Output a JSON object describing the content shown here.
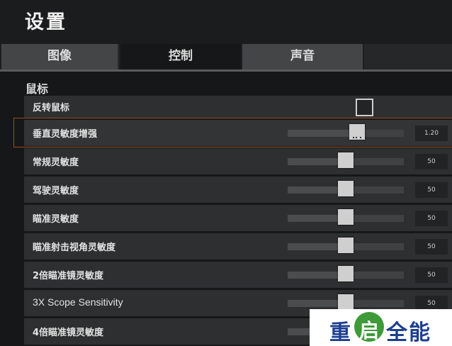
{
  "title": "设置",
  "tabs": [
    {
      "label": "图像"
    },
    {
      "label": "控制"
    },
    {
      "label": "声音"
    },
    {
      "label": ""
    }
  ],
  "section_title": "鼠标",
  "rows": [
    {
      "label": "反转鼠标",
      "type": "checkbox",
      "checked": false
    },
    {
      "label": "垂直灵敏度增强",
      "type": "slider",
      "value": "1.20",
      "level": 0.6,
      "highlighted": true
    },
    {
      "label": "常规灵敏度",
      "type": "slider",
      "value": "50",
      "level": 0.5
    },
    {
      "label": "驾驶灵敏度",
      "type": "slider",
      "value": "50",
      "level": 0.5
    },
    {
      "label": "瞄准灵敏度",
      "type": "slider",
      "value": "50",
      "level": 0.5
    },
    {
      "label": "瞄准射击视角灵敏度",
      "type": "slider",
      "value": "50",
      "level": 0.5
    },
    {
      "label": "2倍瞄准镜灵敏度",
      "type": "slider",
      "value": "50",
      "level": 0.5
    },
    {
      "label": "3X Scope Sensitivity",
      "type": "slider",
      "value": "50",
      "level": 0.5
    },
    {
      "label": "4倍瞄准镜灵敏度",
      "type": "slider",
      "value": "50",
      "level": 0.5
    }
  ],
  "watermark": {
    "pre": "重",
    "mid": "启",
    "post": "全能"
  },
  "colors": {
    "highlight_border": "#a14a25",
    "watermark_blue": "#1e3f8e",
    "watermark_green": "#3f9a3a"
  }
}
